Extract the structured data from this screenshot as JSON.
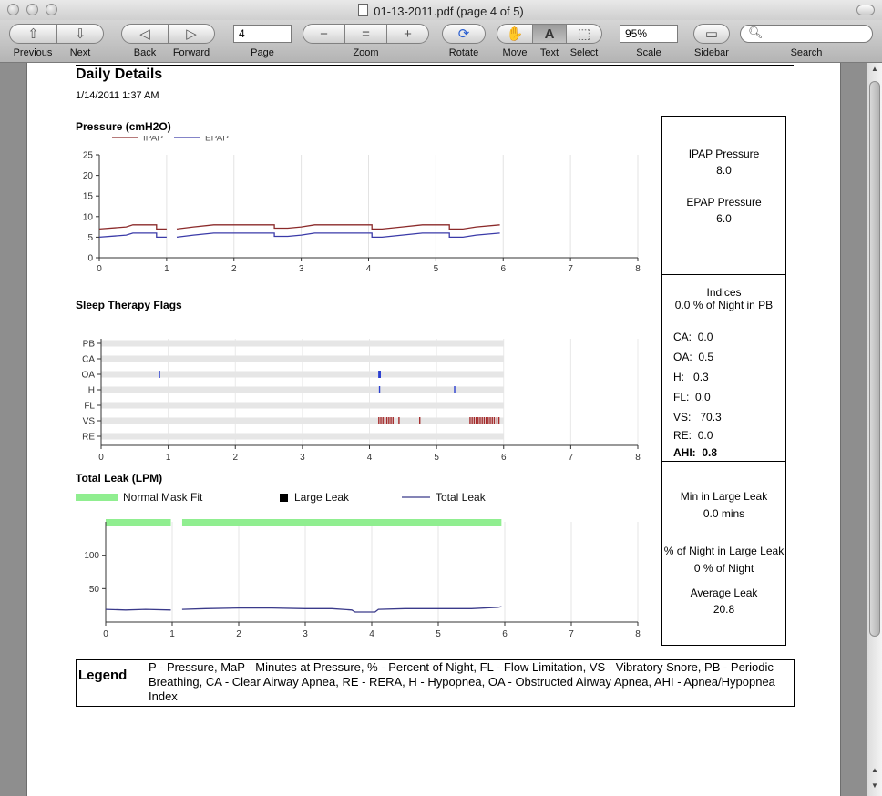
{
  "window": {
    "title": "01-13-2011.pdf (page 4 of 5)"
  },
  "toolbar": {
    "previous": "Previous",
    "next": "Next",
    "back": "Back",
    "forward": "Forward",
    "page_label": "Page",
    "page_value": "4",
    "zoom_label": "Zoom",
    "rotate": "Rotate",
    "move": "Move",
    "text": "Text",
    "select": "Select",
    "scale_label": "Scale",
    "scale_value": "95%",
    "sidebar": "Sidebar",
    "search_label": "Search"
  },
  "report": {
    "title": "Daily Details",
    "date": "1/14/2011 1:37 AM",
    "pressure_title": "Pressure (cmH2O)",
    "flags_title": "Sleep Therapy Flags",
    "leak_title": "Total Leak (LPM)"
  },
  "side": {
    "ipap_label": "IPAP Pressure",
    "ipap_value": "8.0",
    "epap_label": "EPAP Pressure",
    "epap_value": "6.0",
    "indices_label": "Indices",
    "pb_text": "0.0 % of Night in PB",
    "indices": [
      {
        "label": "CA:",
        "value": "0.0"
      },
      {
        "label": "OA:",
        "value": "0.5"
      },
      {
        "label": "H:",
        "value": "0.3"
      },
      {
        "label": "FL:",
        "value": "0.0"
      },
      {
        "label": "VS:",
        "value": "70.3"
      },
      {
        "label": "RE:",
        "value": "0.0"
      },
      {
        "label": "AHI:",
        "value": "0.8"
      }
    ],
    "min_large_label": "Min in Large Leak",
    "min_large_value": "0.0 mins",
    "pct_large_label": "% of Night in Large Leak",
    "pct_large_value": "0 % of Night",
    "avg_leak_label": "Average Leak",
    "avg_leak_value": "20.8"
  },
  "legend": {
    "title": "Legend",
    "text": "P - Pressure, MaP - Minutes at Pressure, % - Percent of Night, FL - Flow Limitation, VS - Vibratory Snore, PB - Periodic Breathing, CA - Clear Airway Apnea, RE - RERA, H - Hypopnea, OA - Obstructed Airway Apnea, AHI - Apnea/Hypopnea Index"
  },
  "chart_data": [
    {
      "type": "line",
      "title": "Pressure (cmH2O)",
      "xlim": [
        0,
        8
      ],
      "ylim": [
        0,
        25
      ],
      "xticks": [
        "0",
        "1",
        "2",
        "3",
        "4",
        "5",
        "6",
        "7",
        "8"
      ],
      "yticks": [
        "0",
        "5",
        "10",
        "15",
        "20",
        "25"
      ],
      "series": [
        {
          "name": "IPAP",
          "color": "#8b2a2a",
          "points": [
            [
              0,
              7
            ],
            [
              0.4,
              7.5
            ],
            [
              0.5,
              8
            ],
            [
              0.85,
              8
            ],
            [
              0.85,
              7
            ],
            [
              1.0,
              7
            ],
            [
              1.0,
              null
            ],
            [
              1.15,
              7
            ],
            [
              1.4,
              7.5
            ],
            [
              1.7,
              8
            ],
            [
              2.6,
              8
            ],
            [
              2.6,
              7.2
            ],
            [
              2.8,
              7.2
            ],
            [
              3.0,
              7.5
            ],
            [
              3.2,
              8
            ],
            [
              4.05,
              8
            ],
            [
              4.05,
              7
            ],
            [
              4.2,
              7
            ],
            [
              4.5,
              7.5
            ],
            [
              4.8,
              8
            ],
            [
              5.2,
              8
            ],
            [
              5.2,
              7
            ],
            [
              5.4,
              7
            ],
            [
              5.6,
              7.5
            ],
            [
              5.95,
              8
            ]
          ]
        },
        {
          "name": "EPAP",
          "color": "#3a3aa8",
          "points": [
            [
              0,
              5
            ],
            [
              0.4,
              5.5
            ],
            [
              0.5,
              6
            ],
            [
              0.85,
              6
            ],
            [
              0.85,
              5
            ],
            [
              1.0,
              5
            ],
            [
              1.0,
              null
            ],
            [
              1.15,
              5
            ],
            [
              1.4,
              5.5
            ],
            [
              1.7,
              6
            ],
            [
              2.6,
              6
            ],
            [
              2.6,
              5.2
            ],
            [
              2.8,
              5.2
            ],
            [
              3.0,
              5.5
            ],
            [
              3.2,
              6
            ],
            [
              4.05,
              6
            ],
            [
              4.05,
              5
            ],
            [
              4.2,
              5
            ],
            [
              4.5,
              5.5
            ],
            [
              4.8,
              6
            ],
            [
              5.2,
              6
            ],
            [
              5.2,
              5
            ],
            [
              5.4,
              5
            ],
            [
              5.6,
              5.5
            ],
            [
              5.95,
              6
            ]
          ]
        }
      ]
    },
    {
      "type": "scatter",
      "title": "Sleep Therapy Flags",
      "xlim": [
        0,
        8
      ],
      "xticks": [
        "0",
        "1",
        "2",
        "3",
        "4",
        "5",
        "6",
        "7",
        "8"
      ],
      "categories": [
        "PB",
        "CA",
        "OA",
        "H",
        "FL",
        "VS",
        "RE"
      ],
      "events": {
        "PB": [],
        "CA": [],
        "OA": [
          0.87,
          4.14,
          4.15,
          4.16
        ],
        "H": [
          4.15,
          5.27
        ],
        "FL": [],
        "VS": [
          4.14,
          4.17,
          4.2,
          4.23,
          4.26,
          4.29,
          4.32,
          4.35,
          4.44,
          4.75,
          5.5,
          5.53,
          5.56,
          5.59,
          5.62,
          5.65,
          5.68,
          5.71,
          5.74,
          5.77,
          5.8,
          5.83,
          5.86,
          5.9,
          5.93
        ],
        "RE": []
      },
      "colors": {
        "OA": "#2a3fd0",
        "H": "#2a3fd0",
        "VS": "#a52a2a"
      }
    },
    {
      "type": "line",
      "title": "Total Leak (LPM)",
      "xlim": [
        0,
        8
      ],
      "ylim": [
        0,
        150
      ],
      "xticks": [
        "0",
        "1",
        "2",
        "3",
        "4",
        "5",
        "6",
        "7",
        "8"
      ],
      "yticks": [
        "50",
        "100"
      ],
      "legend": [
        "Normal Mask Fit",
        "Large Leak",
        "Total Leak"
      ],
      "normal_fit_ranges": [
        [
          0,
          0.98
        ],
        [
          1.15,
          5.95
        ]
      ],
      "normal_fit_color": "#90ee90",
      "large_leak_color": "#000000",
      "series": [
        {
          "name": "Total Leak",
          "color": "#3a3a8a",
          "points": [
            [
              0,
              19
            ],
            [
              0.3,
              18
            ],
            [
              0.6,
              19
            ],
            [
              0.98,
              18
            ],
            [
              0.98,
              null
            ],
            [
              1.15,
              19
            ],
            [
              1.5,
              20
            ],
            [
              2.0,
              21
            ],
            [
              2.5,
              21
            ],
            [
              3.0,
              20
            ],
            [
              3.4,
              20
            ],
            [
              3.7,
              18
            ],
            [
              3.75,
              15
            ],
            [
              4.05,
              15
            ],
            [
              4.1,
              19
            ],
            [
              4.5,
              20
            ],
            [
              5.0,
              20
            ],
            [
              5.5,
              20
            ],
            [
              5.9,
              22
            ],
            [
              5.95,
              23
            ]
          ]
        }
      ]
    }
  ]
}
